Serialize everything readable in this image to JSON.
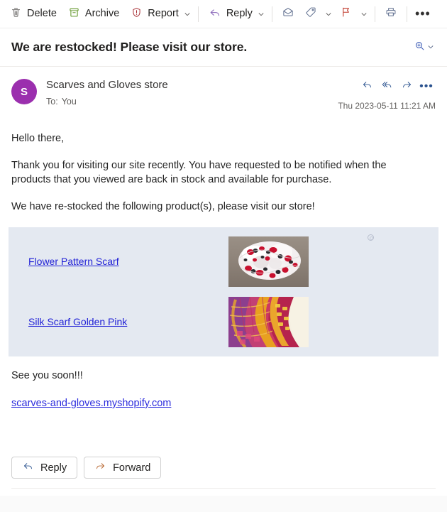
{
  "toolbar": {
    "delete_label": "Delete",
    "archive_label": "Archive",
    "report_label": "Report",
    "reply_label": "Reply",
    "mark_unread_icon": "envelope-icon",
    "categorize_icon": "tag-icon",
    "flag_icon": "flag-icon",
    "print_icon": "printer-icon",
    "more_label": "•••"
  },
  "subject": {
    "title": "We are restocked! Please visit our store.",
    "zoom_icon": "zoom-in-icon"
  },
  "message": {
    "avatar_initial": "S",
    "sender_name": "Scarves and Gloves store",
    "to_label": "To:",
    "to_value": "You",
    "timestamp": "Thu 2023-05-11 11:21 AM",
    "actions": [
      "reply-icon",
      "reply-all-icon",
      "forward-icon",
      "more-icon"
    ]
  },
  "body": {
    "greeting": "Hello there,",
    "paragraph_1": "Thank you for visiting our site recently. You have requested to be notified when the products that you viewed are back in stock and available for purchase.",
    "paragraph_2": "We have re-stocked the following product(s), please visit our store!",
    "closing": "See you soon!!!",
    "store_url": "scarves-and-gloves.myshopify.com"
  },
  "products": {
    "panel_background": "#e4e9f1",
    "link_color": "#1f1fd6",
    "items": [
      {
        "name": "Flower Pattern Scarf",
        "image_alt": "white-red-flower-pattern-scarf"
      },
      {
        "name": "Silk Scarf Golden Pink",
        "image_alt": "golden-pink-silk-scarf"
      }
    ]
  },
  "footer": {
    "reply_label": "Reply",
    "forward_label": "Forward"
  }
}
